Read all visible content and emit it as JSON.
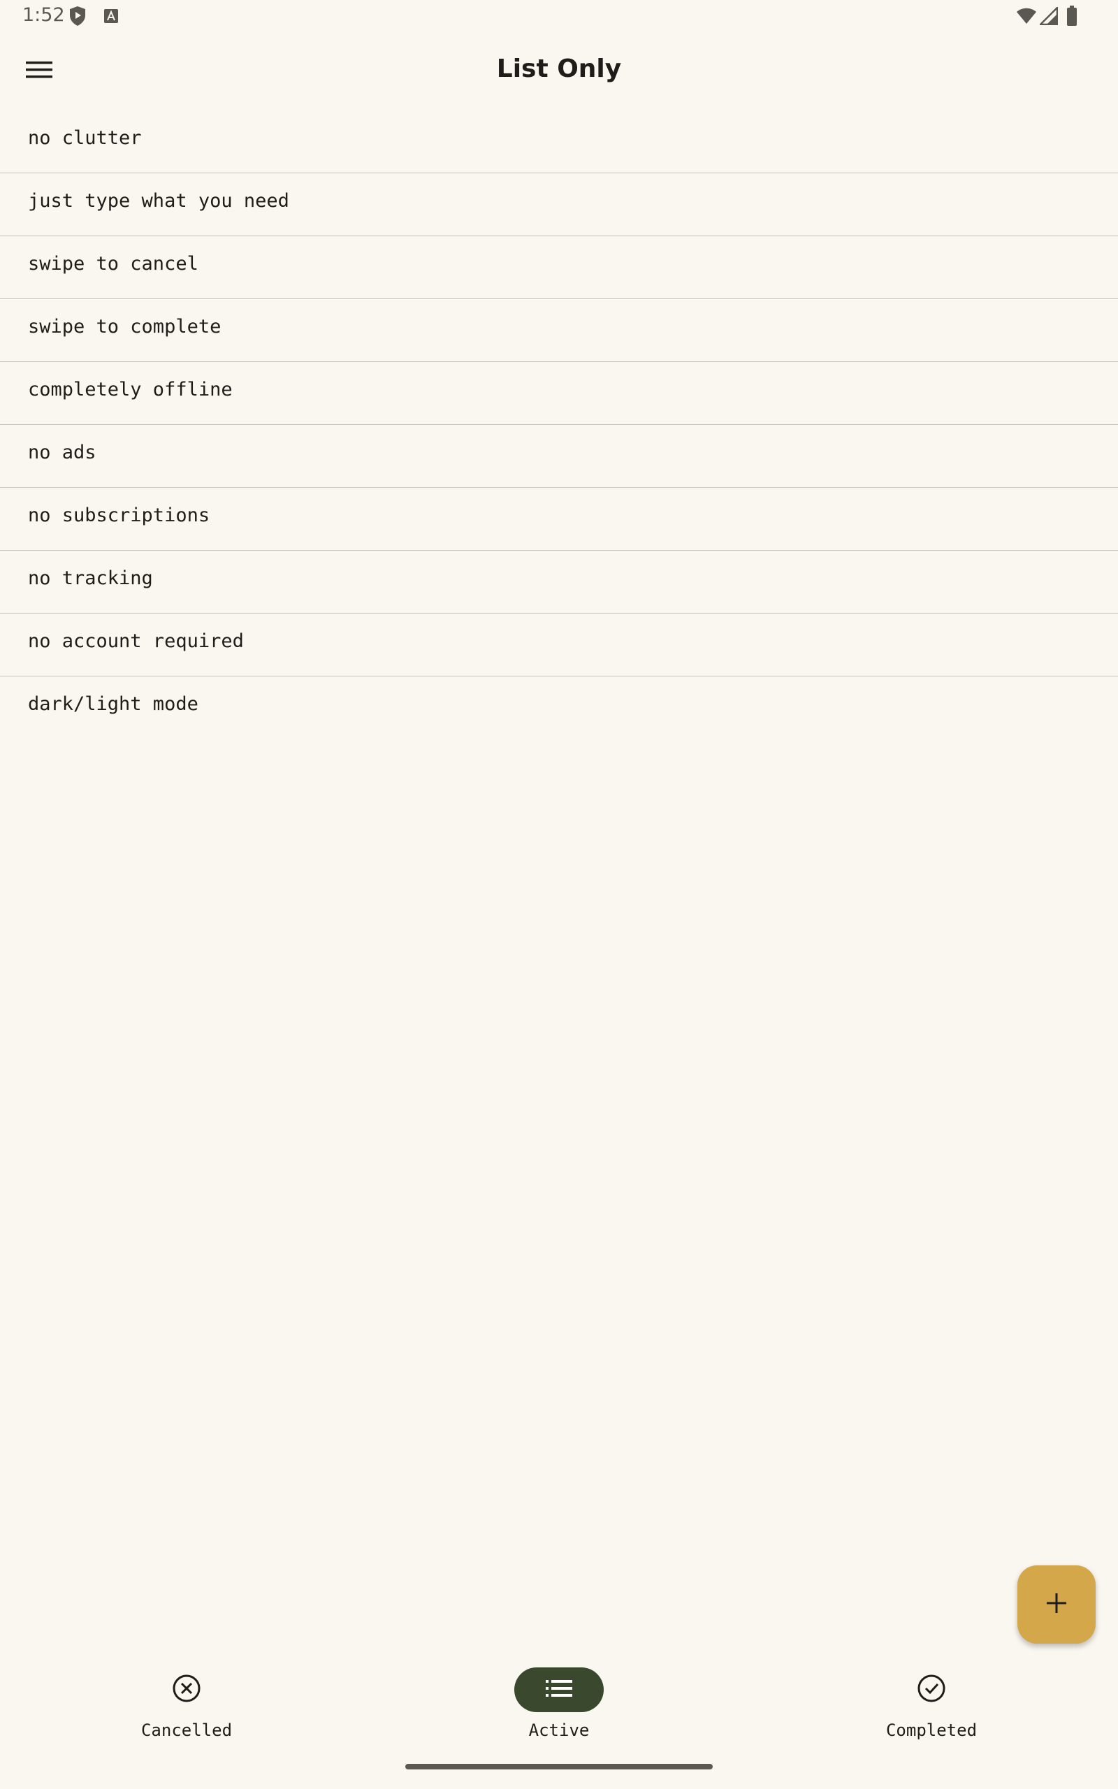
{
  "status_bar": {
    "time": "1:52",
    "left_icons": [
      "shield-play-icon",
      "a-badge-icon"
    ],
    "right_icons": [
      "wifi-icon",
      "signal-icon",
      "battery-icon"
    ]
  },
  "app_bar": {
    "title": "List Only",
    "menu_icon": "hamburger-menu-icon"
  },
  "list": {
    "items": [
      "no clutter",
      "just type what you need",
      "swipe to cancel",
      "swipe to complete",
      "completely offline",
      "no ads",
      "no subscriptions",
      "no tracking",
      "no account required",
      "dark/light mode"
    ]
  },
  "fab": {
    "icon": "plus-icon",
    "color": "#d4a84a"
  },
  "bottom_nav": {
    "items": [
      {
        "label": "Cancelled",
        "icon": "cancel-circle-icon",
        "active": false
      },
      {
        "label": "Active",
        "icon": "list-icon",
        "active": true
      },
      {
        "label": "Completed",
        "icon": "check-circle-icon",
        "active": false
      }
    ],
    "active_color": "#3a482d"
  },
  "colors": {
    "background": "#faf7f0",
    "divider": "#c8c5bd",
    "text": "#1f1d1a"
  }
}
